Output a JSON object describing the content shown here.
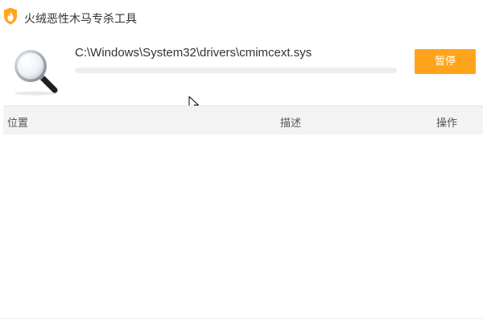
{
  "app": {
    "title": "火绒恶性木马专杀工具",
    "logo_icon": "huorong-flame-shield-logo",
    "accent_color": "#ffa41c"
  },
  "scan": {
    "icon": "magnifier-icon",
    "current_file": "C:\\Windows\\System32\\drivers\\cmimcext.sys",
    "progress_percent": 0,
    "pause_label": "暂停"
  },
  "table": {
    "columns": {
      "location": "位置",
      "description": "描述",
      "action": "操作"
    },
    "rows": []
  }
}
